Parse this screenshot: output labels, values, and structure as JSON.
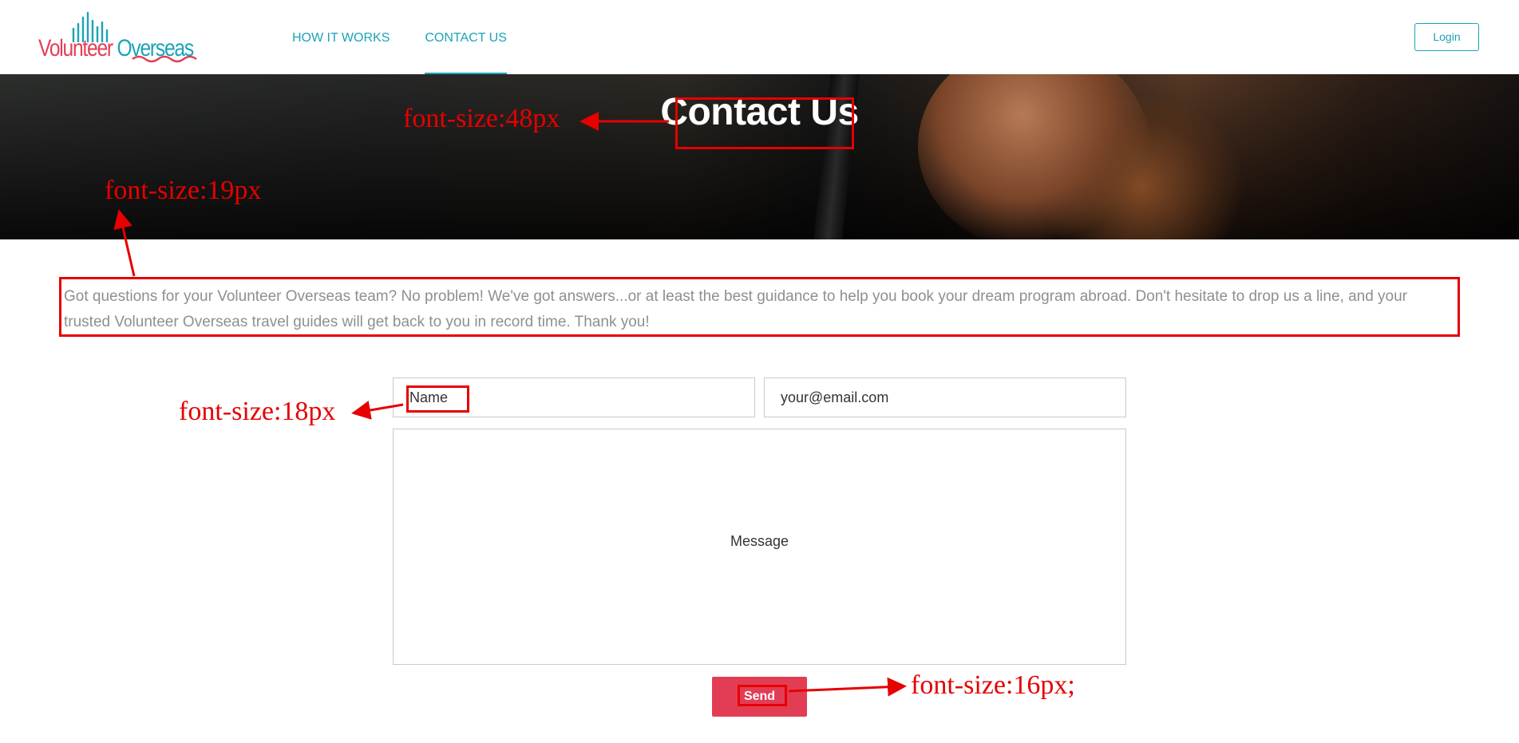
{
  "brand": {
    "logo_word1": "Volunteer",
    "logo_word2": "Overseas",
    "colors": {
      "accent_teal": "#1ba3b8",
      "accent_red": "#e33d55"
    }
  },
  "nav": {
    "items": [
      {
        "label": "HOW IT WORKS",
        "active": false
      },
      {
        "label": "CONTACT US",
        "active": true
      }
    ],
    "login_label": "Login"
  },
  "hero": {
    "title": "Contact Us"
  },
  "intro": {
    "text": "Got questions for your Volunteer Overseas team? No problem! We've got answers...or at least the best guidance to help you book your dream program abroad. Don't hesitate to drop us a line, and your trusted Volunteer Overseas travel guides will get back to you in record time. Thank you!"
  },
  "form": {
    "name_placeholder": "Name",
    "email_placeholder": "your@email.com",
    "message_placeholder": "Message",
    "send_label": "Send"
  },
  "annotations": {
    "title_font": "font-size:48px",
    "intro_font": "font-size:19px",
    "input_font": "font-size:18px",
    "button_font": "font-size:16px;",
    "color": "#e60000"
  }
}
